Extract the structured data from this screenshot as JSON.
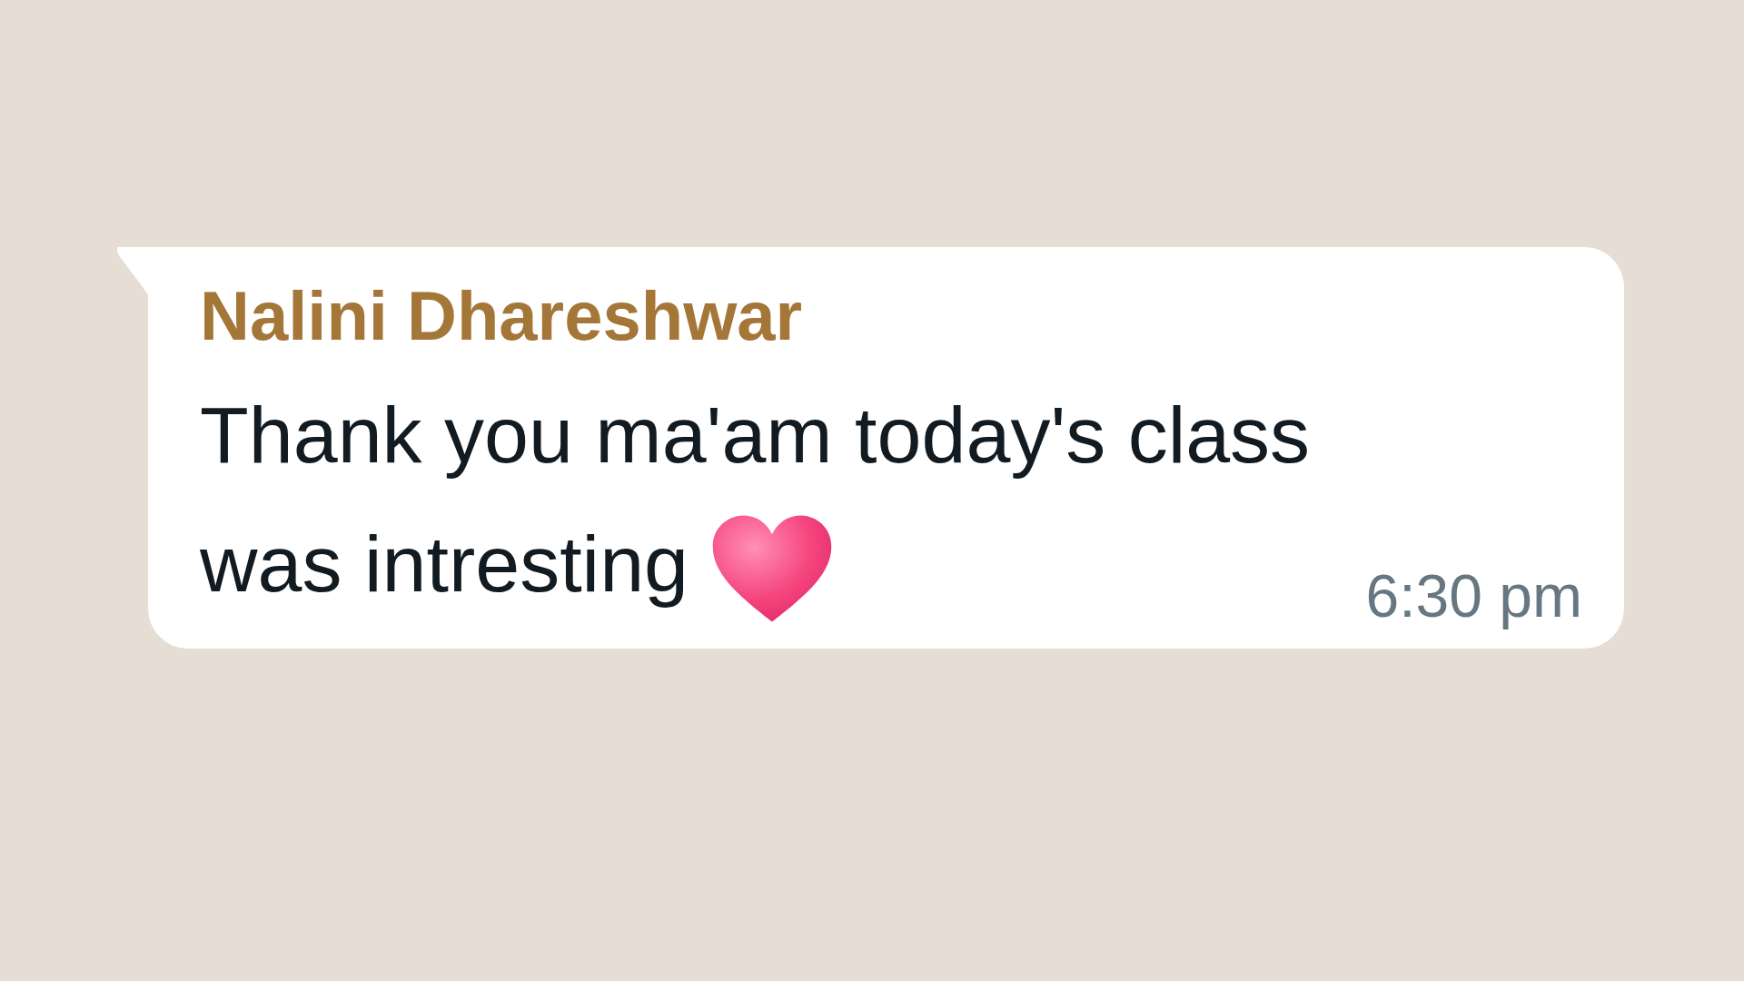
{
  "message": {
    "sender": "Nalini Dhareshwar",
    "lines": [
      "Thank you ma'am today's class",
      "was intresting"
    ],
    "time": "6:30 pm"
  }
}
